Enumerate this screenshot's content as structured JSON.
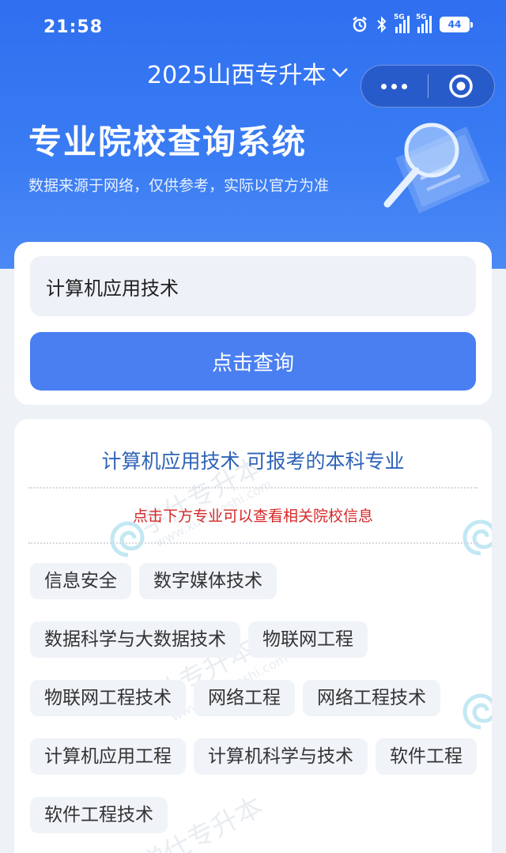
{
  "status_bar": {
    "time": "21:58",
    "network_label": "5G",
    "battery": "44"
  },
  "header": {
    "title": "2025山西专升本",
    "heading": "专业院校查询系统",
    "subtitle": "数据来源于网络，仅供参考，实际以官方为准"
  },
  "search": {
    "value": "计算机应用技术",
    "button_label": "点击查询"
  },
  "results": {
    "title": "计算机应用技术 可报考的本科专业",
    "hint": "点击下方专业可以查看相关院校信息",
    "majors": [
      "信息安全",
      "数字媒体技术",
      "数据科学与大数据技术",
      "物联网工程",
      "物联网工程技术",
      "网络工程",
      "网络工程技术",
      "计算机应用工程",
      "计算机科学与技术",
      "软件工程",
      "软件工程技术"
    ]
  },
  "watermark": {
    "text": "学仕专升本",
    "url": "www.xueyueshi.com"
  },
  "colors": {
    "primary": "#3a7cf3",
    "button": "#4a7ff2",
    "result_title": "#2e63b7",
    "hint": "#d62828"
  }
}
